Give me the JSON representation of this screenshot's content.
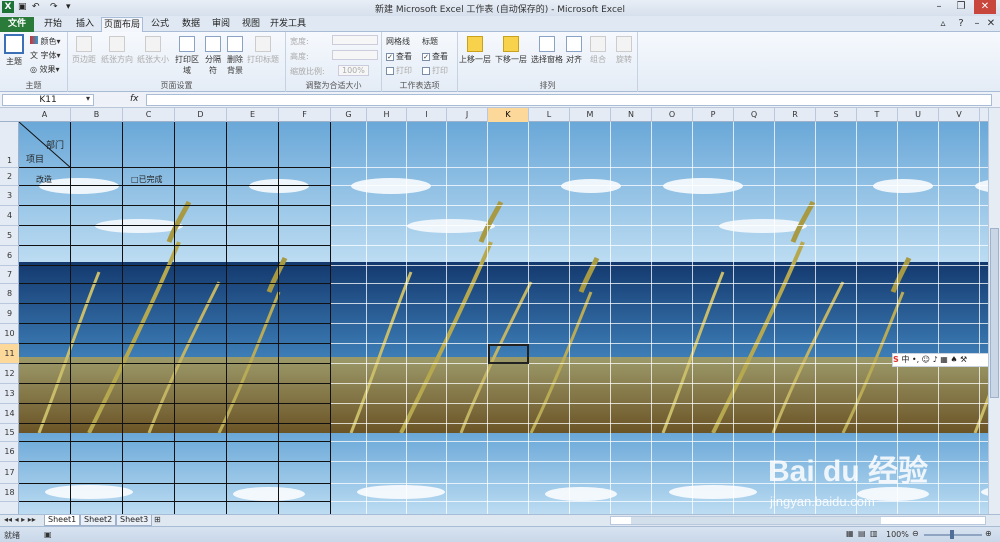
{
  "window": {
    "title": "新建 Microsoft Excel 工作表 (自动保存的) - Microsoft Excel"
  },
  "tabs": [
    {
      "label": "文件",
      "kind": "file"
    },
    {
      "label": "开始"
    },
    {
      "label": "插入"
    },
    {
      "label": "页面布局",
      "active": true
    },
    {
      "label": "公式"
    },
    {
      "label": "数据"
    },
    {
      "label": "审阅"
    },
    {
      "label": "视图"
    },
    {
      "label": "开发工具"
    }
  ],
  "ribbon": {
    "theme": {
      "main": "主题",
      "colors": "颜色",
      "fonts": "字体",
      "effects": "效果",
      "group": "主题"
    },
    "page_setup": {
      "margins": "页边距",
      "orientation": "纸张方向",
      "size": "纸张大小",
      "print_area": "打印区域",
      "breaks": "分隔符",
      "background": "删除背景",
      "print_titles": "打印标题",
      "group": "页面设置"
    },
    "scale": {
      "width": "宽度:",
      "height": "高度:",
      "scale_label": "缩放比例:",
      "scale_value": "100%",
      "group": "调整为合适大小"
    },
    "sheet_options": {
      "gridlines": "网格线",
      "headings": "标题",
      "view": "查看",
      "print": "打印",
      "group": "工作表选项"
    },
    "arrange": {
      "bring_forward": "上移一层",
      "send_backward": "下移一层",
      "selection_pane": "选择窗格",
      "align": "对齐",
      "group_btn": "组合",
      "rotate": "旋转",
      "group": "排列"
    }
  },
  "formula_bar": {
    "name_box": "K11",
    "fx": "fx",
    "content": ""
  },
  "columns": [
    "A",
    "B",
    "C",
    "D",
    "E",
    "F",
    "G",
    "H",
    "I",
    "J",
    "K",
    "L",
    "M",
    "N",
    "O",
    "P",
    "Q",
    "R",
    "S",
    "T",
    "U",
    "V"
  ],
  "selected_column": "K",
  "rows": [
    "1",
    "2",
    "3",
    "4",
    "5",
    "6",
    "7",
    "8",
    "9",
    "10",
    "11",
    "12",
    "13",
    "14",
    "15",
    "16",
    "17",
    "18"
  ],
  "selected_row": "11",
  "cells": {
    "header_dept": "部门",
    "header_item": "项目",
    "a2": "改造",
    "c2_check": "□",
    "c2": "已完成"
  },
  "sheets": [
    {
      "label": "Sheet1",
      "active": true
    },
    {
      "label": "Sheet2"
    },
    {
      "label": "Sheet3"
    }
  ],
  "status": {
    "ready": "就绪",
    "zoom": "100%"
  },
  "ime": {
    "label": "中"
  },
  "watermark": {
    "brand": "Bai du 经验",
    "url": "jingyan.baidu.com"
  },
  "colors": {
    "sky": "#7fb8e0",
    "sea": "#1c4f86",
    "grass": "#b7a25a",
    "file_tab": "#2a7a3a",
    "selected_header": "#fcd99a"
  }
}
